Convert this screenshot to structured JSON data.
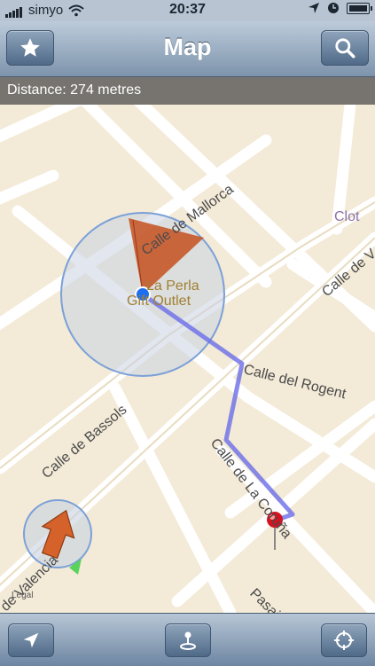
{
  "status": {
    "carrier": "simyo",
    "time": "20:37"
  },
  "nav": {
    "title": "Map",
    "left_icon": "star-icon",
    "right_icon": "search-icon"
  },
  "info": {
    "distance_text": "Distance: 274 metres"
  },
  "map": {
    "streets": {
      "mallorca": "Calle de Mallorca",
      "rogent": "Calle del Rogent",
      "bassols": "Calle de Bassols",
      "corunya": "Calle de La Coruña",
      "valencia": "de Valencia",
      "pasaje": "Pasaje",
      "right_top": "Calle de V"
    },
    "district": "Clot",
    "poi_line1": "La Perla",
    "poi_line2": "Gift Outlet",
    "legal": "Legal",
    "route_color": "#6a6ee8",
    "accuracy_color": "#7aa0d8",
    "pin_color": "#d4131f"
  },
  "toolbar": {
    "locate_icon": "location-arrow-icon",
    "joystick_icon": "joystick-icon",
    "target_icon": "crosshair-icon"
  }
}
